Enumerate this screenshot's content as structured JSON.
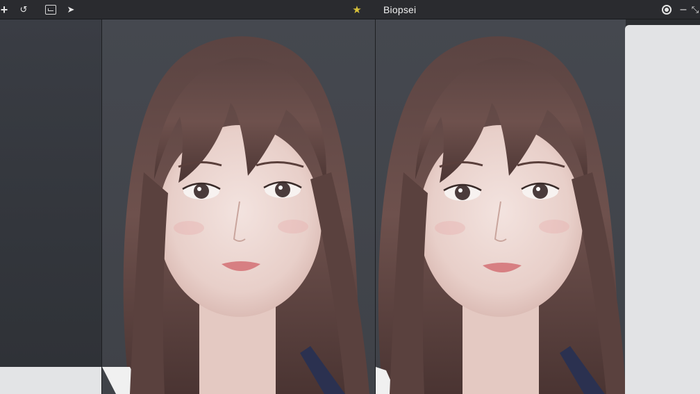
{
  "toolbar": {
    "add_glyph": "+",
    "undo_glyph": "↺",
    "pointer_glyph": "➤",
    "star_glyph": "★",
    "right_title": "Biopsei",
    "minimize_glyph": "–",
    "collapse_glyph": "⤡"
  },
  "viewports": {
    "left": {
      "content": "portrait-image"
    },
    "right": {
      "content": "portrait-image"
    }
  },
  "colors": {
    "accent_star": "#d9c23a",
    "panel_light": "#e2e3e5",
    "toolbar_bg": "#2a2b2f"
  }
}
